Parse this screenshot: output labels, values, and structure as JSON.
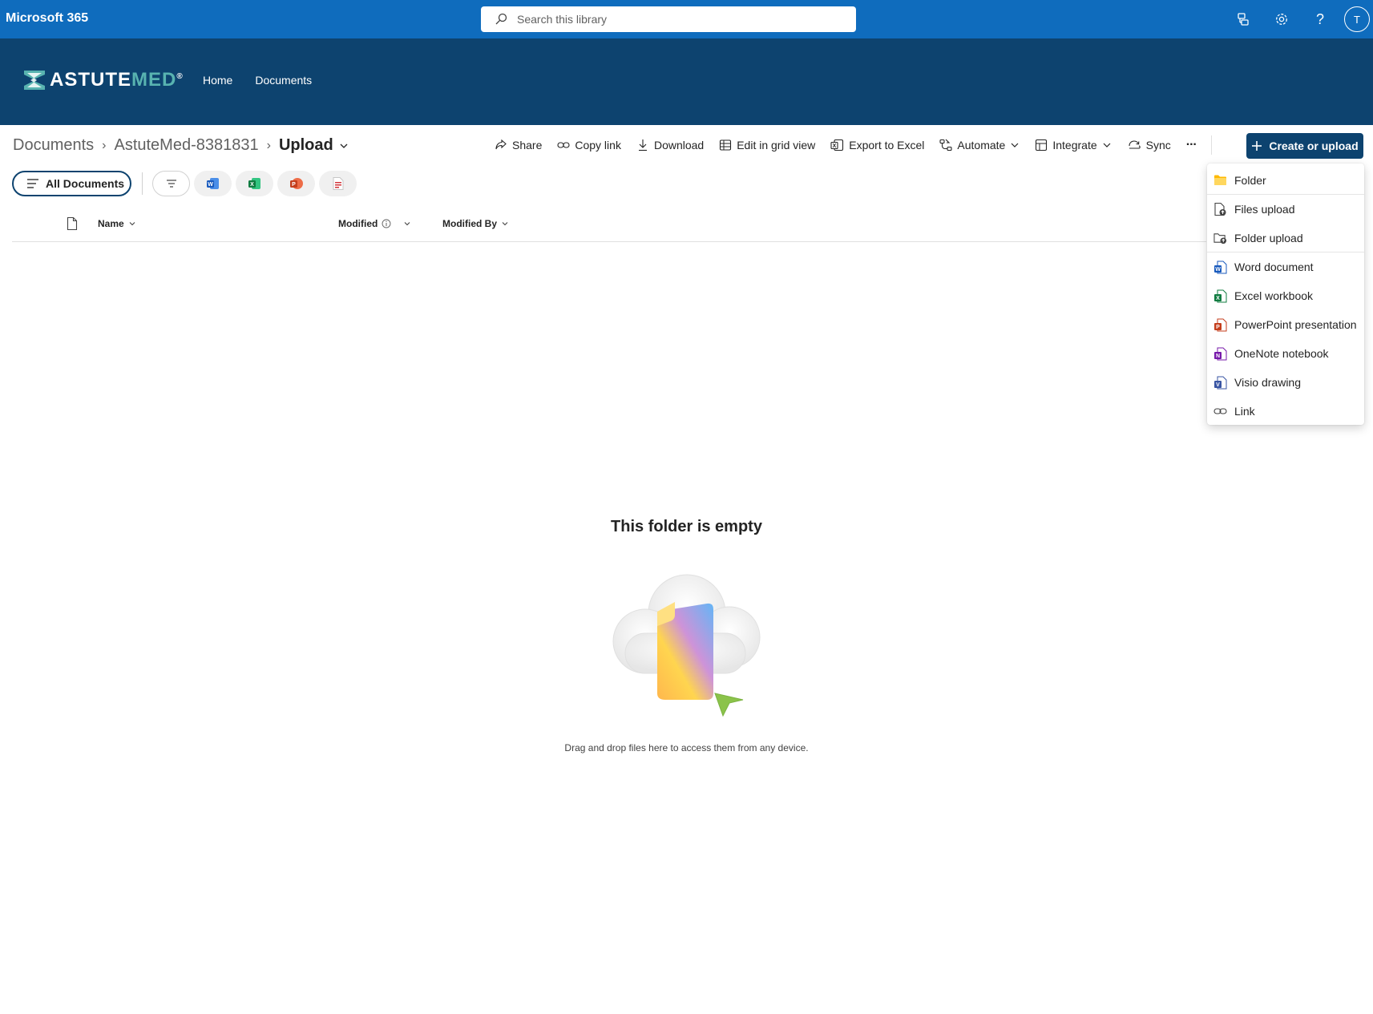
{
  "suitebar": {
    "title": "Microsoft 365",
    "search_placeholder": "Search this library",
    "avatar_initial": "T",
    "color": "#0f6cbd"
  },
  "site": {
    "logo_a": "ASTUTE",
    "logo_b": "MED",
    "logo_mark": "®",
    "nav": [
      "Home",
      "Documents"
    ],
    "color": "#0d436f"
  },
  "breadcrumb": {
    "items": [
      "Documents",
      "AstuteMed-8381831"
    ],
    "current": "Upload"
  },
  "commands": {
    "share": "Share",
    "copy_link": "Copy link",
    "download": "Download",
    "edit_grid": "Edit in grid view",
    "export_excel": "Export to Excel",
    "automate": "Automate",
    "integrate": "Integrate",
    "sync": "Sync",
    "more": "···",
    "create": "Create or upload"
  },
  "view": {
    "label": "All Documents"
  },
  "columns": {
    "name": "Name",
    "modified": "Modified",
    "modified_by": "Modified By"
  },
  "empty": {
    "title": "This folder is empty",
    "subtitle": "Drag and drop files here to access them from any device."
  },
  "menu": {
    "items": [
      {
        "label": "Folder",
        "icon": "folder-icon"
      },
      {
        "label": "Files upload",
        "icon": "file-upload-icon"
      },
      {
        "label": "Folder upload",
        "icon": "folder-upload-icon"
      },
      {
        "label": "Word document",
        "icon": "word-icon"
      },
      {
        "label": "Excel workbook",
        "icon": "excel-icon"
      },
      {
        "label": "PowerPoint presentation",
        "icon": "powerpoint-icon"
      },
      {
        "label": "OneNote notebook",
        "icon": "onenote-icon"
      },
      {
        "label": "Visio drawing",
        "icon": "visio-icon"
      },
      {
        "label": "Link",
        "icon": "link-icon"
      }
    ]
  }
}
